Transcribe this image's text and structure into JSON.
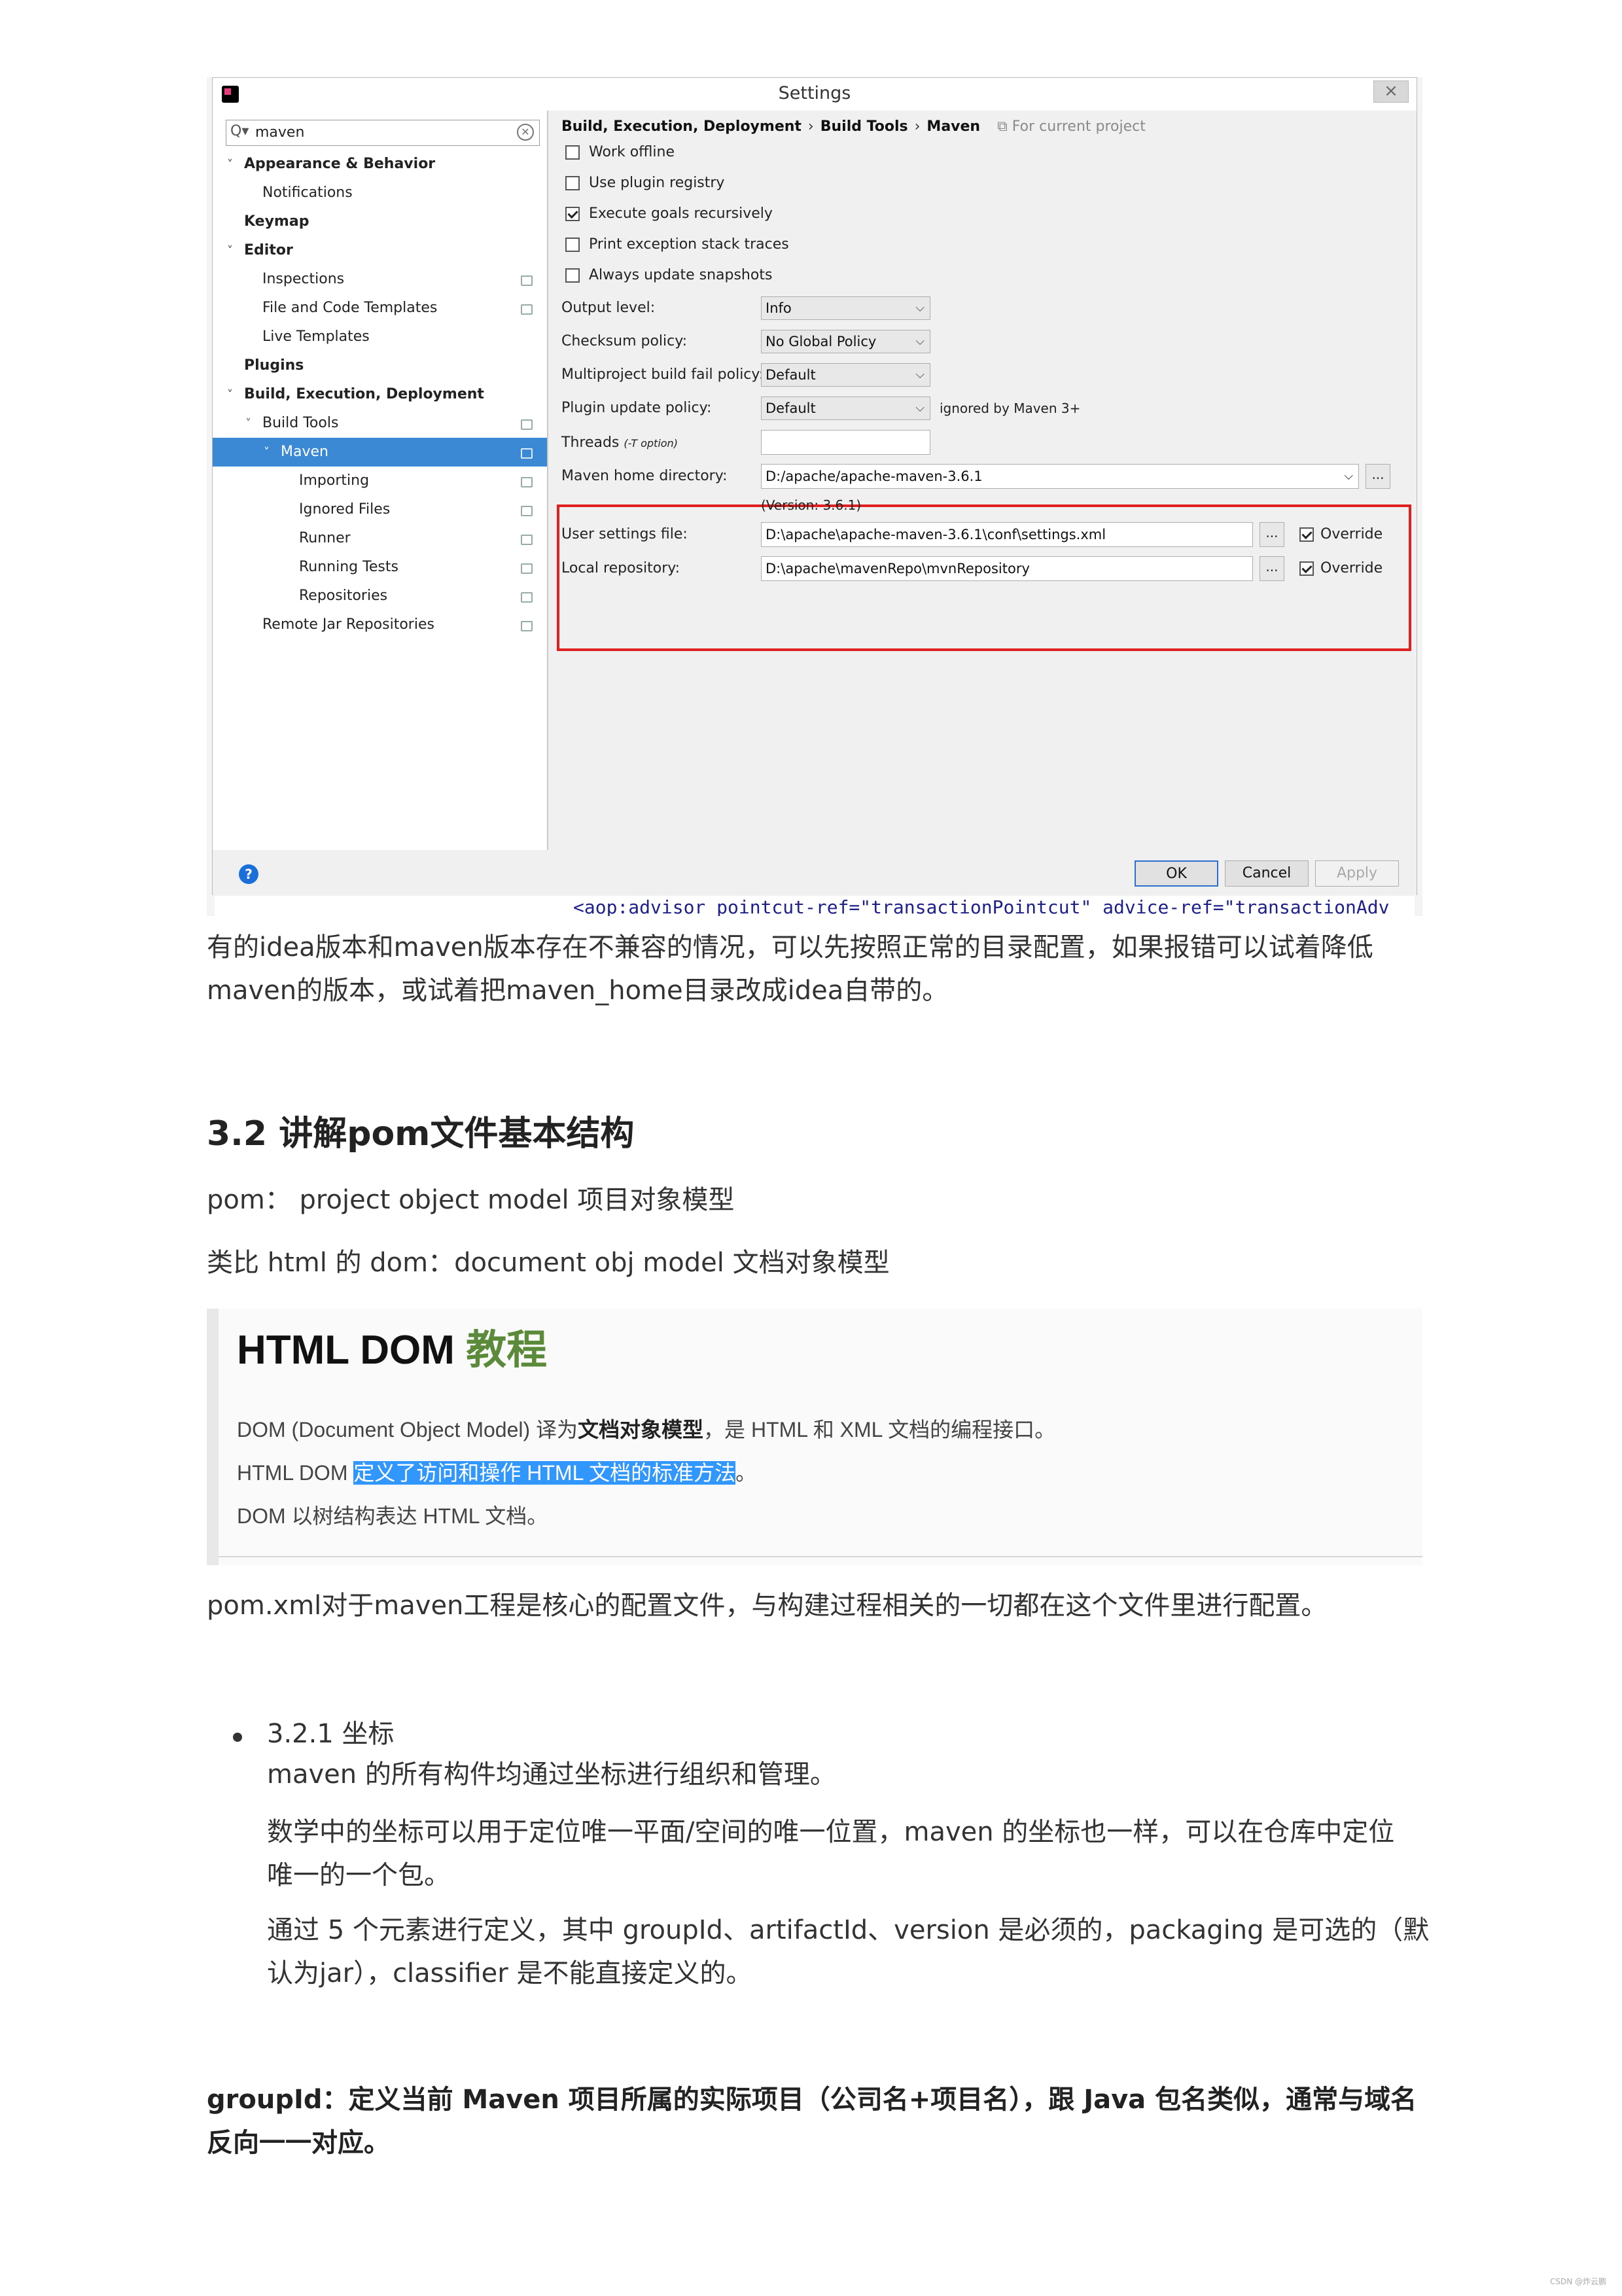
{
  "settings": {
    "title": "Settings",
    "close": "×",
    "search_value": "maven",
    "search_icon": "Q▾",
    "clear_icon": "✕",
    "tree": [
      {
        "label": "Appearance & Behavior",
        "arrow": "˅",
        "bold": true
      },
      {
        "label": "Notifications"
      },
      {
        "label": "Keymap",
        "bold": true
      },
      {
        "label": "Editor",
        "arrow": "˅",
        "bold": true
      },
      {
        "label": "Inspections"
      },
      {
        "label": "File and Code Templates"
      },
      {
        "label": "Live Templates"
      },
      {
        "label": "Plugins",
        "bold": true
      },
      {
        "label": "Build, Execution, Deployment",
        "arrow": "˅",
        "bold": true
      },
      {
        "label": "Build Tools",
        "arrow": "˅"
      },
      {
        "label": "Maven",
        "arrow": "˅",
        "selected": true
      },
      {
        "label": "Importing"
      },
      {
        "label": "Ignored Files"
      },
      {
        "label": "Runner"
      },
      {
        "label": "Running Tests"
      },
      {
        "label": "Repositories"
      },
      {
        "label": "Remote Jar Repositories"
      }
    ],
    "breadcrumb": [
      "Build, Execution, Deployment",
      "Build Tools",
      "Maven"
    ],
    "breadcrumb_sep": "›",
    "for_current_project": "⧉ For current project",
    "checkboxes": [
      {
        "label": "Work offline",
        "checked": false
      },
      {
        "label": "Use plugin registry",
        "checked": false
      },
      {
        "label": "Execute goals recursively",
        "checked": true
      },
      {
        "label": "Print exception stack traces",
        "checked": false
      },
      {
        "label": "Always update snapshots",
        "checked": false
      }
    ],
    "output_level": {
      "label": "Output level:",
      "value": "Info"
    },
    "checksum_policy": {
      "label": "Checksum policy:",
      "value": "No Global Policy"
    },
    "multiproject_fail": {
      "label": "Multiproject build fail policy:",
      "value": "Default"
    },
    "plugin_update": {
      "label": "Plugin update policy:",
      "value": "Default",
      "note": "ignored by Maven 3+"
    },
    "threads": {
      "label": "Threads",
      "hint": "(-T option)",
      "value": ""
    },
    "maven_home": {
      "label": "Maven home directory:",
      "value": "D:/apache/apache-maven-3.6.1",
      "version": "(Version: 3.6.1)"
    },
    "user_settings": {
      "label": "User settings file:",
      "value": "D:\\apache\\apache-maven-3.6.1\\conf\\settings.xml",
      "override": "Override"
    },
    "local_repo": {
      "label": "Local repository:",
      "value": "D:\\apache\\mavenRepo\\mvnRepository",
      "override": "Override"
    },
    "browse": "...",
    "help": "?",
    "buttons": {
      "ok": "OK",
      "cancel": "Cancel",
      "apply": "Apply"
    },
    "chevron": "⌵",
    "behind_code": "<aop:advisor pointcut-ref=\"transactionPointcut\" advice-ref=\"transactionAdv"
  },
  "article": {
    "para1_line1": "有的idea版本和maven版本存在不兼容的情况，可以先按照正常的目录配置，如果报错可以试着降低",
    "para1_line2": "maven的版本，或试着把maven_home目录改成idea自带的。",
    "heading": "3.2 讲解pom文件基本结构",
    "pom_def": "pom：  project object model 项目对象模型",
    "dom_def": "类比 html 的 dom：document obj model 文档对象模型",
    "dom_img": {
      "title_a": "HTML DOM ",
      "title_b": "教程",
      "line1_a": "DOM (Document Object Model) 译为",
      "line1_b": "文档对象模型",
      "line1_c": "，是 HTML 和 XML 文档的编程接口。",
      "line2_a": "HTML DOM ",
      "line2_b": "定义了访问和操作 HTML 文档的标准方法",
      "line2_c": "。",
      "line3": "DOM 以树结构表达 HTML 文档。"
    },
    "pomxml": "pom.xml对于maven工程是核心的配置文件，与构建过程相关的一切都在这个文件里进行配置。",
    "coord_title": "3.2.1 坐标",
    "coord_1": "maven 的所有构件均通过坐标进行组织和管理。",
    "coord_2a": "数学中的坐标可以用于定位唯一平面/空间的唯一位置，maven 的坐标也一样，可以在仓库中定位",
    "coord_2b": "唯一的一个包。",
    "coord_3a": "通过 5 个元素进行定义，其中 groupId、artifactId、version 是必须的，packaging 是可选的（默",
    "coord_3b": "认为jar），classifier 是不能直接定义的。",
    "groupid_a": "groupId：定义当前 Maven 项目所属的实际项目（公司名+项目名），跟 Java 包名类似，通常与域名",
    "groupid_b": "反向一一对应。",
    "watermark": "CSDN @炸云鹏"
  }
}
